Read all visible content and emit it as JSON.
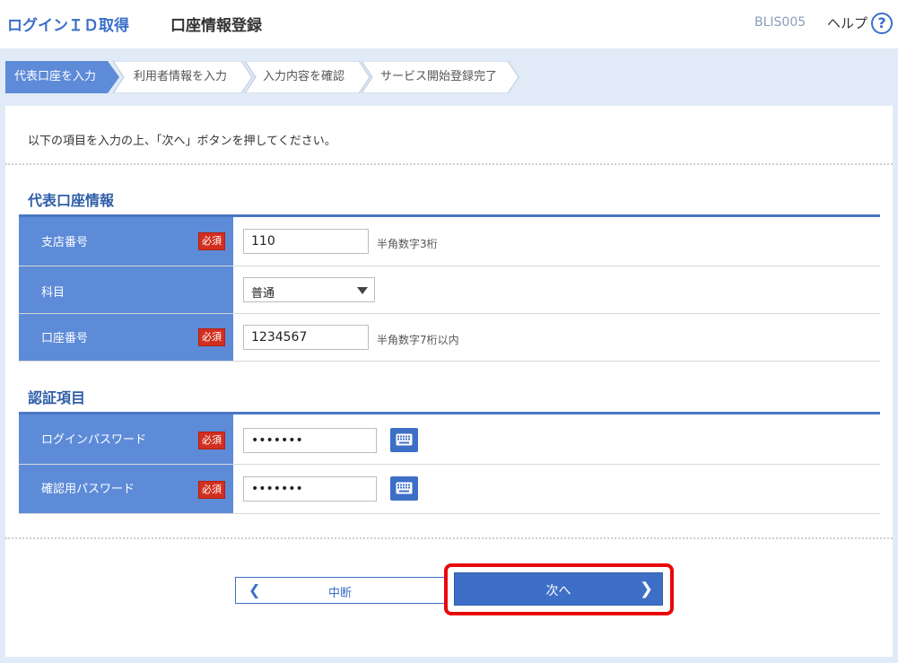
{
  "header": {
    "app_title": "ログインＩＤ取得",
    "page_title": "口座情報登録",
    "screen_id": "BLIS005",
    "help_label": "ヘルプ",
    "help_icon": "?"
  },
  "steps": [
    {
      "label": "代表口座を入力",
      "active": true
    },
    {
      "label": "利用者情報を入力",
      "active": false
    },
    {
      "label": "入力内容を確認",
      "active": false
    },
    {
      "label": "サービス開始登録完了",
      "active": false
    }
  ],
  "instruction": "以下の項目を入力の上、「次へ」ボタンを押してください。",
  "account_section": {
    "title": "代表口座情報",
    "branch": {
      "label": "支店番号",
      "required_badge": "必須",
      "value": "110",
      "hint": "半角数字3桁"
    },
    "subject": {
      "label": "科目",
      "selected": "普通"
    },
    "account_number": {
      "label": "口座番号",
      "required_badge": "必須",
      "value": "1234567",
      "hint": "半角数字7桁以内"
    }
  },
  "auth_section": {
    "title": "認証項目",
    "login_password": {
      "label": "ログインパスワード",
      "required_badge": "必須",
      "value": "•••••••"
    },
    "confirm_password": {
      "label": "確認用パスワード",
      "required_badge": "必須",
      "value": "•••••••"
    }
  },
  "buttons": {
    "cancel_label": "中断",
    "next_label": "次へ"
  },
  "colors": {
    "accent": "#3d6fc7",
    "row_header": "#5d8bd8",
    "required": "#d12f1f",
    "highlight": "#e8080a",
    "background": "#e1ebf7"
  },
  "icons": {
    "keyboard": "keyboard-icon",
    "help": "help-icon",
    "select_arrow": "chevron-down-icon"
  }
}
